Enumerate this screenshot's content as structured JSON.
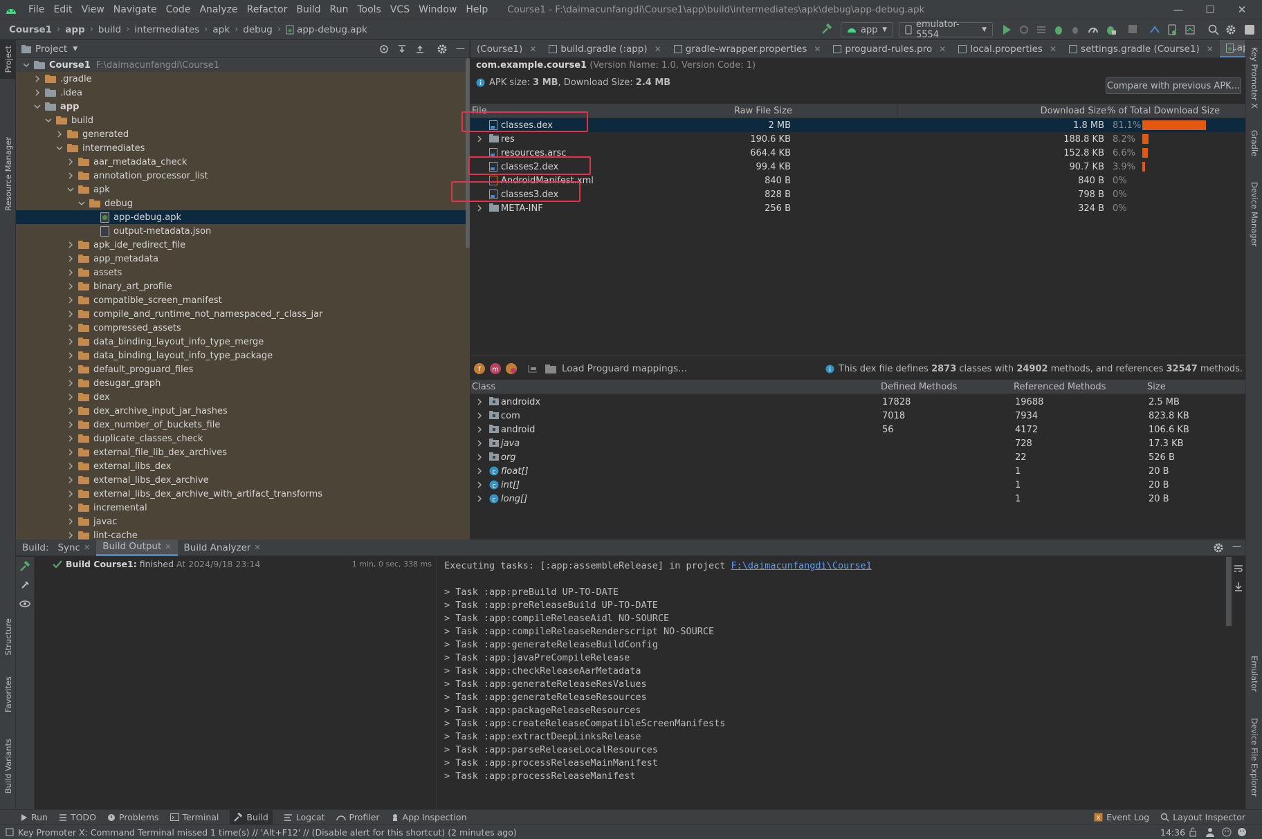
{
  "menu": {
    "items": [
      "File",
      "Edit",
      "View",
      "Navigate",
      "Code",
      "Analyze",
      "Refactor",
      "Build",
      "Run",
      "Tools",
      "VCS",
      "Window",
      "Help"
    ],
    "title": "Course1 - F:\\daimacunfangdi\\Course1\\app\\build\\intermediates\\apk\\debug\\app-debug.apk"
  },
  "breadcrumb": [
    "Course1",
    "app",
    "build",
    "intermediates",
    "apk",
    "debug",
    "app-debug.apk"
  ],
  "toolbar": {
    "run_config": "app",
    "device": "emulator-5554"
  },
  "left_strip": [
    "Project",
    "Resource Manager",
    "Structure",
    "Favorites",
    "Build Variants"
  ],
  "right_strip": [
    "Key Promoter X",
    "Gradle",
    "Device Manager",
    "Emulator",
    "Device File Explorer"
  ],
  "project_panel": {
    "title": "Project",
    "tree": [
      {
        "label": "Course1",
        "path": "F:\\daimacunfangdi\\Course1",
        "depth": 0,
        "open": true,
        "type": "module",
        "bold": true
      },
      {
        "label": ".gradle",
        "depth": 1,
        "open": false,
        "type": "folder"
      },
      {
        "label": ".idea",
        "depth": 1,
        "open": false,
        "type": "gfolder"
      },
      {
        "label": "app",
        "depth": 1,
        "open": true,
        "type": "module",
        "bold": true
      },
      {
        "label": "build",
        "depth": 2,
        "open": true,
        "type": "folder"
      },
      {
        "label": "generated",
        "depth": 3,
        "open": false,
        "type": "folder"
      },
      {
        "label": "intermediates",
        "depth": 3,
        "open": true,
        "type": "folder"
      },
      {
        "label": "aar_metadata_check",
        "depth": 4,
        "open": false,
        "type": "folder"
      },
      {
        "label": "annotation_processor_list",
        "depth": 4,
        "open": false,
        "type": "folder"
      },
      {
        "label": "apk",
        "depth": 4,
        "open": true,
        "type": "folder"
      },
      {
        "label": "debug",
        "depth": 5,
        "open": true,
        "type": "folder"
      },
      {
        "label": "app-debug.apk",
        "depth": 6,
        "type": "apk",
        "selected": true
      },
      {
        "label": "output-metadata.json",
        "depth": 6,
        "type": "file"
      },
      {
        "label": "apk_ide_redirect_file",
        "depth": 4,
        "open": false,
        "type": "folder"
      },
      {
        "label": "app_metadata",
        "depth": 4,
        "open": false,
        "type": "folder"
      },
      {
        "label": "assets",
        "depth": 4,
        "open": false,
        "type": "folder"
      },
      {
        "label": "binary_art_profile",
        "depth": 4,
        "open": false,
        "type": "folder"
      },
      {
        "label": "compatible_screen_manifest",
        "depth": 4,
        "open": false,
        "type": "folder"
      },
      {
        "label": "compile_and_runtime_not_namespaced_r_class_jar",
        "depth": 4,
        "open": false,
        "type": "folder"
      },
      {
        "label": "compressed_assets",
        "depth": 4,
        "open": false,
        "type": "folder"
      },
      {
        "label": "data_binding_layout_info_type_merge",
        "depth": 4,
        "open": false,
        "type": "folder"
      },
      {
        "label": "data_binding_layout_info_type_package",
        "depth": 4,
        "open": false,
        "type": "folder"
      },
      {
        "label": "default_proguard_files",
        "depth": 4,
        "open": false,
        "type": "folder"
      },
      {
        "label": "desugar_graph",
        "depth": 4,
        "open": false,
        "type": "folder"
      },
      {
        "label": "dex",
        "depth": 4,
        "open": false,
        "type": "folder"
      },
      {
        "label": "dex_archive_input_jar_hashes",
        "depth": 4,
        "open": false,
        "type": "folder"
      },
      {
        "label": "dex_number_of_buckets_file",
        "depth": 4,
        "open": false,
        "type": "folder"
      },
      {
        "label": "duplicate_classes_check",
        "depth": 4,
        "open": false,
        "type": "folder"
      },
      {
        "label": "external_file_lib_dex_archives",
        "depth": 4,
        "open": false,
        "type": "folder"
      },
      {
        "label": "external_libs_dex",
        "depth": 4,
        "open": false,
        "type": "folder"
      },
      {
        "label": "external_libs_dex_archive",
        "depth": 4,
        "open": false,
        "type": "folder"
      },
      {
        "label": "external_libs_dex_archive_with_artifact_transforms",
        "depth": 4,
        "open": false,
        "type": "folder"
      },
      {
        "label": "incremental",
        "depth": 4,
        "open": false,
        "type": "folder"
      },
      {
        "label": "javac",
        "depth": 4,
        "open": false,
        "type": "folder"
      },
      {
        "label": "lint-cache",
        "depth": 4,
        "open": false,
        "type": "folder"
      }
    ]
  },
  "editor_tabs": [
    {
      "label": "(Course1)",
      "active": false
    },
    {
      "label": "build.gradle (:app)",
      "active": false
    },
    {
      "label": "gradle-wrapper.properties",
      "active": false
    },
    {
      "label": "proguard-rules.pro",
      "active": false
    },
    {
      "label": "local.properties",
      "active": false
    },
    {
      "label": "settings.gradle (Course1)",
      "active": false
    },
    {
      "label": "app-debug.apk",
      "active": true
    }
  ],
  "apk": {
    "package": "com.example.course1",
    "version_info": "(Version Name: 1.0, Version Code: 1)",
    "apk_size_label": "APK size:",
    "apk_size": "3 MB",
    "download_size_label": ", Download Size:",
    "download_size": "2.4 MB",
    "compare_button": "Compare with previous APK...",
    "columns": [
      "File",
      "Raw File Size",
      "Download Size",
      "% of Total Download Size"
    ],
    "files": [
      {
        "name": "classes.dex",
        "raw": "2 MB",
        "download": "1.8 MB",
        "percent": "81.1%",
        "pct": 81.1,
        "expandable": false,
        "selected": true,
        "icon": "dex"
      },
      {
        "name": "res",
        "raw": "190.6 KB",
        "download": "188.8 KB",
        "percent": "8.2%",
        "pct": 8.2,
        "expandable": true,
        "icon": "folder"
      },
      {
        "name": "resources.arsc",
        "raw": "664.4 KB",
        "download": "152.8 KB",
        "percent": "6.6%",
        "pct": 6.6,
        "expandable": false,
        "icon": "file"
      },
      {
        "name": "classes2.dex",
        "raw": "99.4 KB",
        "download": "90.7 KB",
        "percent": "3.9%",
        "pct": 3.9,
        "expandable": false,
        "icon": "dex"
      },
      {
        "name": "AndroidManifest.xml",
        "raw": "840 B",
        "download": "840 B",
        "percent": "0%",
        "pct": 0,
        "expandable": false,
        "icon": "xml"
      },
      {
        "name": "classes3.dex",
        "raw": "828 B",
        "download": "798 B",
        "percent": "0%",
        "pct": 0,
        "expandable": false,
        "icon": "dex"
      },
      {
        "name": "META-INF",
        "raw": "256 B",
        "download": "324 B",
        "percent": "0%",
        "pct": 0,
        "expandable": true,
        "icon": "folder"
      }
    ],
    "dex_toolbar": {
      "load_mappings": "Load Proguard mappings...",
      "info_prefix": "This dex file defines",
      "classes": "2873",
      "classes_word": "classes with",
      "methods": "24902",
      "methods_word": "methods, and references",
      "refs": "32547",
      "refs_word": "methods."
    },
    "class_columns": [
      "Class",
      "Defined Methods",
      "Referenced Methods",
      "Size"
    ],
    "classes": [
      {
        "name": "androidx",
        "defined": "17828",
        "referenced": "19688",
        "size": "2.5 MB",
        "kind": "package",
        "italic": false
      },
      {
        "name": "com",
        "defined": "7018",
        "referenced": "7934",
        "size": "823.8 KB",
        "kind": "package",
        "italic": false
      },
      {
        "name": "android",
        "defined": "56",
        "referenced": "4172",
        "size": "106.6 KB",
        "kind": "package",
        "italic": false
      },
      {
        "name": "java",
        "defined": "",
        "referenced": "728",
        "size": "17.3 KB",
        "kind": "package",
        "italic": true
      },
      {
        "name": "org",
        "defined": "",
        "referenced": "22",
        "size": "526 B",
        "kind": "package",
        "italic": true
      },
      {
        "name": "float[]",
        "defined": "",
        "referenced": "1",
        "size": "20 B",
        "kind": "class",
        "italic": true
      },
      {
        "name": "int[]",
        "defined": "",
        "referenced": "1",
        "size": "20 B",
        "kind": "class",
        "italic": true
      },
      {
        "name": "long[]",
        "defined": "",
        "referenced": "1",
        "size": "20 B",
        "kind": "class",
        "italic": true
      }
    ]
  },
  "build": {
    "label": "Build:",
    "tabs": [
      {
        "label": "Sync",
        "active": false,
        "closable": true
      },
      {
        "label": "Build Output",
        "active": true,
        "closable": true
      },
      {
        "label": "Build Analyzer",
        "active": false,
        "closable": true
      }
    ],
    "result_title": "Build Course1:",
    "result_status": "finished",
    "result_time": "At 2024/9/18 23:14",
    "duration": "1 min, 0 sec, 338 ms",
    "exec_prefix": "Executing tasks: [:app:assembleRelease] in project ",
    "exec_link": "F:\\daimacunfangdi\\Course1",
    "lines": [
      "> Task :app:preBuild UP-TO-DATE",
      "> Task :app:preReleaseBuild UP-TO-DATE",
      "> Task :app:compileReleaseAidl NO-SOURCE",
      "> Task :app:compileReleaseRenderscript NO-SOURCE",
      "> Task :app:generateReleaseBuildConfig",
      "> Task :app:javaPreCompileRelease",
      "> Task :app:checkReleaseAarMetadata",
      "> Task :app:generateReleaseResValues",
      "> Task :app:generateReleaseResources",
      "> Task :app:packageReleaseResources",
      "> Task :app:createReleaseCompatibleScreenManifests",
      "> Task :app:extractDeepLinksRelease",
      "> Task :app:parseReleaseLocalResources",
      "> Task :app:processReleaseMainManifest",
      "> Task :app:processReleaseManifest"
    ]
  },
  "bottom_tools": [
    "Run",
    "TODO",
    "Problems",
    "Terminal",
    "Build",
    "Logcat",
    "Profiler",
    "App Inspection"
  ],
  "bottom_right": [
    "Event Log",
    "Layout Inspector"
  ],
  "status": {
    "message": "Key Promoter X: Command Terminal missed 1 time(s) // 'Alt+F12' // (Disable alert for this shortcut) (2 minutes ago)",
    "time": "14:36"
  },
  "colors": {
    "accent": "#4a88c7",
    "bar": "#e5590f",
    "selection": "#0d293e",
    "highlight_box": "#e0344a",
    "success": "#59a869"
  }
}
